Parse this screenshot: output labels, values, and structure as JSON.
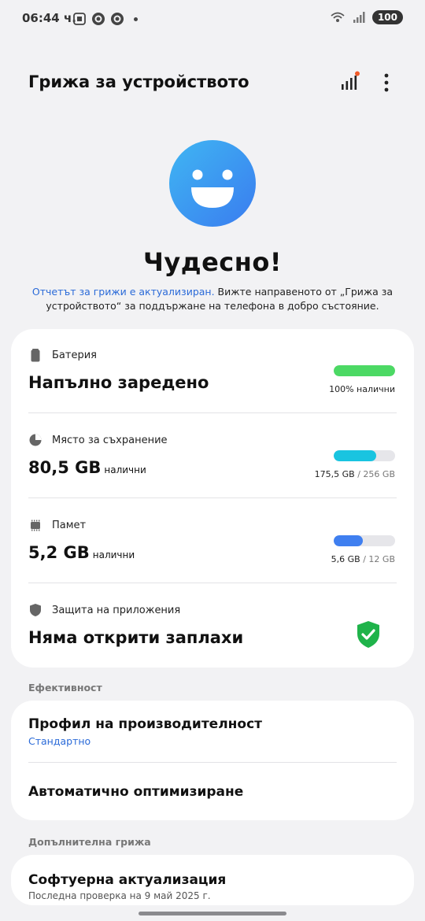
{
  "status_bar": {
    "time": "06:44 ч.",
    "battery": "100"
  },
  "app_bar": {
    "title": "Грижа за устройството"
  },
  "hero": {
    "title": "Чудесно!",
    "link_text": "Отчетът за грижи е актуализиран.",
    "description": " Вижте направеното от „Грижа за устройството“ за поддържане на телефона в добро състояние."
  },
  "battery": {
    "label": "Батерия",
    "value": "Напълно заредено",
    "caption": "100% налични",
    "fill_percent": 100,
    "color": "#4cd964"
  },
  "storage": {
    "label": "Място за съхранение",
    "value": "80,5 GB",
    "value_sub": "налични",
    "caption_used": "175,5 GB",
    "caption_total": " / 256 GB",
    "fill_percent": 69,
    "color": "#19c4e0"
  },
  "memory": {
    "label": "Памет",
    "value": "5,2 GB",
    "value_sub": "налични",
    "caption_used": "5,6 GB",
    "caption_total": " / 12 GB",
    "fill_percent": 47,
    "color": "#3f7ff0"
  },
  "app_protection": {
    "label": "Защита на приложения",
    "value": "Няма открити заплахи",
    "color": "#1fb34a"
  },
  "efficiency": {
    "section": "Ефективност",
    "profile_title": "Профил на производителност",
    "profile_value": "Стандартно",
    "auto_optimize": "Автоматично оптимизиране"
  },
  "additional_care": {
    "section": "Допълнителна грижа",
    "software_update": "Софтуерна актуализация",
    "last_checked": "Последна проверка на 9 май 2025 г."
  }
}
